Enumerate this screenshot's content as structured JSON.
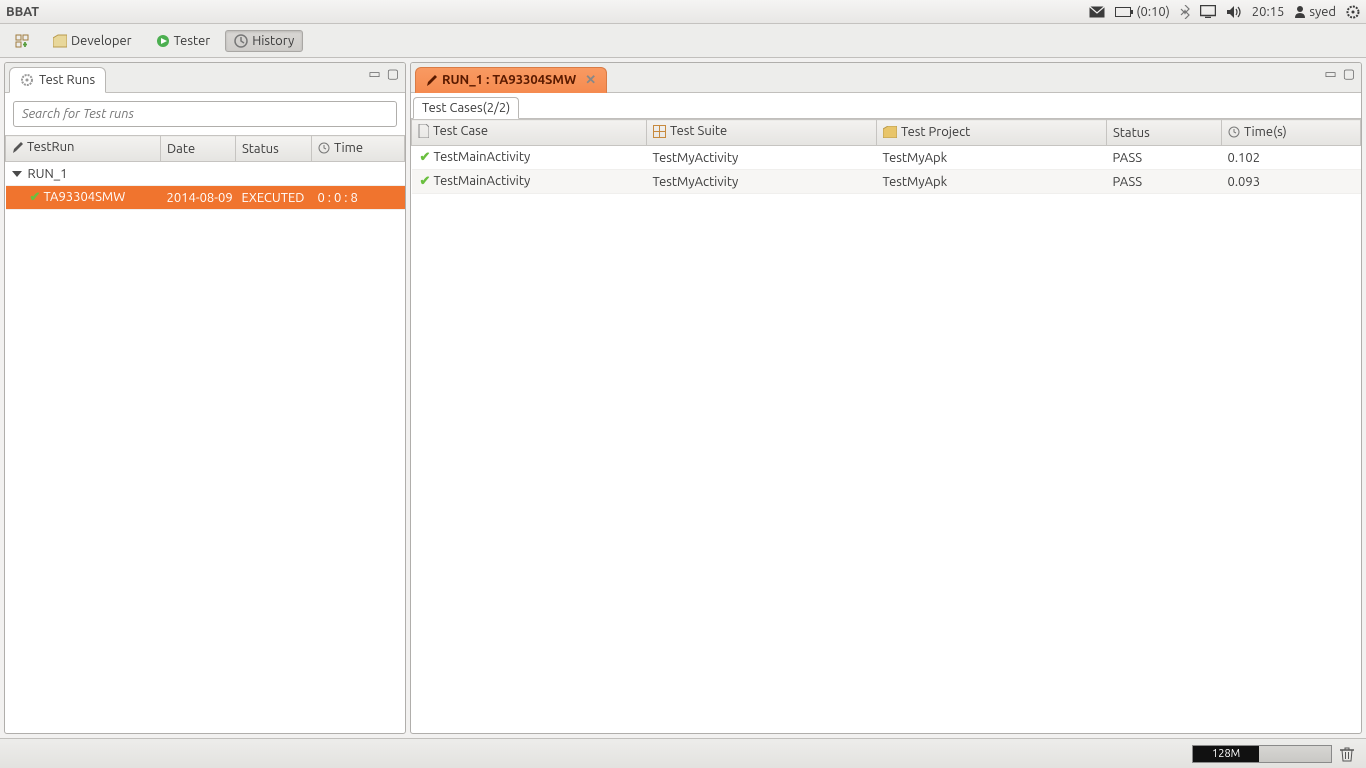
{
  "menubar": {
    "app_title": "BBAT",
    "battery": "(0:10)",
    "clock": "20:15",
    "user": "syed"
  },
  "toolbar": {
    "perspectives": [
      {
        "label": "Developer",
        "icon": "folder"
      },
      {
        "label": "Tester",
        "icon": "play"
      },
      {
        "label": "History",
        "icon": "clock",
        "active": true
      }
    ]
  },
  "left": {
    "tab_title": "Test Runs",
    "search_placeholder": "Search for Test runs",
    "columns": {
      "testrun": "TestRun",
      "date": "Date",
      "status": "Status",
      "time": "Time"
    },
    "rows": [
      {
        "type": "parent",
        "name": "RUN_1",
        "date": "",
        "status": "",
        "time": ""
      },
      {
        "type": "child",
        "name": "TA93304SMW",
        "date": "2014-08-09",
        "status": "EXECUTED",
        "time": "0 : 0 : 8",
        "selected": true
      }
    ]
  },
  "right": {
    "tab_title": "RUN_1 : TA93304SMW",
    "sub_tab": "Test Cases(2/2)",
    "columns": {
      "testcase": "Test Case",
      "testsuite": "Test Suite",
      "testproject": "Test Project",
      "status": "Status",
      "time": "Time(s)"
    },
    "rows": [
      {
        "case": "TestMainActivity",
        "suite": "TestMyActivity",
        "project": "TestMyApk",
        "status": "PASS",
        "time": "0.102"
      },
      {
        "case": "TestMainActivity",
        "suite": "TestMyActivity",
        "project": "TestMyApk",
        "status": "PASS",
        "time": "0.093"
      }
    ]
  },
  "statusbar": {
    "heap_label": "128M"
  }
}
